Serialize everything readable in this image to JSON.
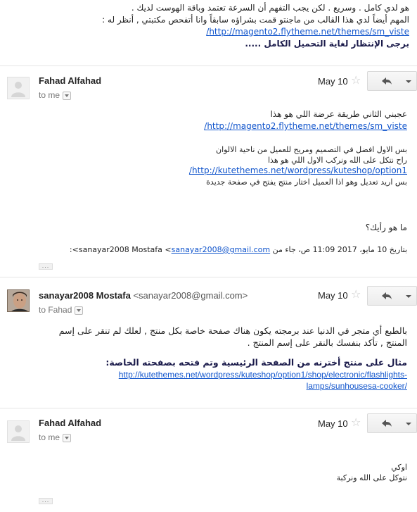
{
  "top_message": {
    "line1": "هو لدي كامل . وسريع . لكن يجب التفهم أن السرعة تعتمد وباقة الهوست لديك .",
    "line2": "المهم أيضاً لدي هذا القالب من ماجنتو قمت بشراؤه سابقاً وانا أتفحص مكتبتي , أنظر له :",
    "link": "http://magento2.flytheme.net/themes/sm_viste/",
    "bold_line": "برجى الإنتظار لغاية التحميل الكامل ....."
  },
  "messages": [
    {
      "sender": "Fahad Alfahad",
      "sender_email": "",
      "to": "to me",
      "date": "May 10",
      "body": {
        "line1": "عجبني الثاني طريقة عرضة اللي هو هذا",
        "link1": "http://magento2.flytheme.net/themes/sm_viste/",
        "line2": "بس الاول افضل في التصميم ومريح للعميل من ناحية الالوان",
        "line3": "راح نتكل على الله ونركب الاول اللي هو هذا",
        "link2": "http://kutethemes.net/wordpress/kuteshop/option1/",
        "line4": "بس اريد تعديل وهو اذا العميل اختار منتج يفتح في صفحة جديدة",
        "question": "ما هو رأيك؟",
        "quote_prefix": "بتاريخ 10 مايو، 2017 11:09 ص، جاء من sanayar2008 Mostafa <",
        "quote_email": "sanayar2008@gmail.com",
        "quote_suffix": ">:"
      }
    },
    {
      "sender": "sanayar2008 Mostafa",
      "sender_email": "<sanayar2008@gmail.com>",
      "to": "to Fahad",
      "date": "May 10",
      "body": {
        "line1": "بالطبع أي متجر في الدنيا عند برمجته يكون هناك صفحة خاصة بكل منتج , لعلك لم تنقر على إسم",
        "line2": "المنتج , تأكد بنفسك بالنقر على إسم المنتج .",
        "bold_line": "مثال على منتج أخترنه من الصفحة الرئيسية وتم فتحه بصفحته الخاصة:",
        "link_line1": "http://kutethemes.net/wordpress/kuteshop/option1/shop/electronic/flashlights-",
        "link_line2": "lamps/sunhousesa-cooker/"
      }
    },
    {
      "sender": "Fahad Alfahad",
      "sender_email": "",
      "to": "to me",
      "date": "May 10",
      "body": {
        "line1": "اوكي",
        "line2": "نتوكل على الله ونركبة"
      }
    }
  ],
  "icons": {
    "star": "star-icon",
    "reply": "reply-arrow-icon",
    "more": "chevron-down-icon",
    "avatar_placeholder": "person-icon"
  },
  "colors": {
    "link": "#1155cc",
    "separator": "#e5e5e5"
  }
}
